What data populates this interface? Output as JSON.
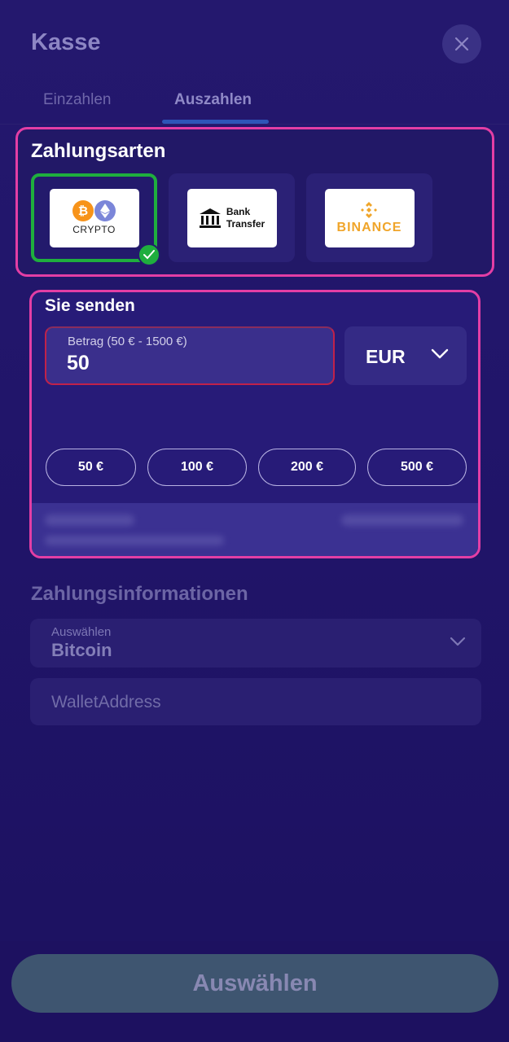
{
  "header": {
    "title": "Kasse"
  },
  "tabs": [
    {
      "label": "Einzahlen",
      "active": false
    },
    {
      "label": "Auszahlen",
      "active": true
    }
  ],
  "payment_methods": {
    "title": "Zahlungsarten",
    "items": [
      {
        "label": "CRYPTO",
        "selected": true
      },
      {
        "label_line1": "Bank",
        "label_line2": "Transfer",
        "selected": false
      },
      {
        "label": "BINANCE",
        "selected": false
      }
    ]
  },
  "send": {
    "title": "Sie senden",
    "amount_label": "Betrag (50 € - 1500 €)",
    "amount_value": "50",
    "currency": "EUR",
    "presets": [
      "50 €",
      "100 €",
      "200 €",
      "500 €"
    ]
  },
  "payment_info": {
    "title": "Zahlungsinformationen",
    "select_label": "Auswählen",
    "select_value": "Bitcoin",
    "wallet_placeholder": "WalletAddress"
  },
  "footer": {
    "submit_label": "Auswählen"
  },
  "colors": {
    "background": "#21156a",
    "highlight": "#e33ea5",
    "selected": "#1fae3e",
    "error_border": "#c0224a",
    "button": "#3e5570"
  }
}
